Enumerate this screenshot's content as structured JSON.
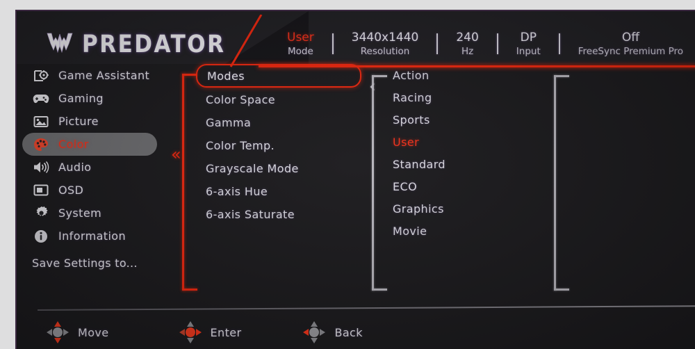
{
  "brand": {
    "name": "PREDATOR",
    "logo_icon": "predator-logo-icon"
  },
  "header": {
    "status": [
      {
        "value": "User",
        "label": "Mode",
        "accent": true
      },
      {
        "value": "3440x1440",
        "label": "Resolution",
        "accent": false
      },
      {
        "value": "240",
        "label": "Hz",
        "accent": false
      },
      {
        "value": "DP",
        "label": "Input",
        "accent": false
      },
      {
        "value": "Off",
        "label": "FreeSync Premium Pro",
        "accent": false
      }
    ]
  },
  "sidebar": {
    "items": [
      {
        "label": "Game Assistant",
        "icon": "game-assistant-icon",
        "active": false
      },
      {
        "label": "Gaming",
        "icon": "gamepad-icon",
        "active": false
      },
      {
        "label": "Picture",
        "icon": "picture-icon",
        "active": false
      },
      {
        "label": "Color",
        "icon": "palette-icon",
        "active": true
      },
      {
        "label": "Audio",
        "icon": "speaker-icon",
        "active": false
      },
      {
        "label": "OSD",
        "icon": "osd-icon",
        "active": false
      },
      {
        "label": "System",
        "icon": "gear-icon",
        "active": false
      },
      {
        "label": "Information",
        "icon": "info-icon",
        "active": false
      }
    ],
    "save_settings": "Save Settings to..."
  },
  "submenu": {
    "items": [
      {
        "label": "Modes",
        "selected": true
      },
      {
        "label": "Color Space",
        "selected": false
      },
      {
        "label": "Gamma",
        "selected": false
      },
      {
        "label": "Color Temp.",
        "selected": false
      },
      {
        "label": "Grayscale Mode",
        "selected": false
      },
      {
        "label": "6-axis Hue",
        "selected": false
      },
      {
        "label": "6-axis Saturate",
        "selected": false
      }
    ]
  },
  "options": {
    "items": [
      {
        "label": "Action",
        "active": false
      },
      {
        "label": "Racing",
        "active": false
      },
      {
        "label": "Sports",
        "active": false
      },
      {
        "label": "User",
        "active": true
      },
      {
        "label": "Standard",
        "active": false
      },
      {
        "label": "ECO",
        "active": false
      },
      {
        "label": "Graphics",
        "active": false
      },
      {
        "label": "Movie",
        "active": false
      }
    ]
  },
  "footer": {
    "items": [
      {
        "label": "Move",
        "icon": "dpad-move-icon"
      },
      {
        "label": "Enter",
        "icon": "dpad-enter-icon"
      },
      {
        "label": "Back",
        "icon": "dpad-back-icon"
      }
    ]
  },
  "colors": {
    "accent_red": "#f0270e",
    "text_light": "#e4e3e9",
    "panel_bg": "#1b1a1d",
    "highlight_gray": "#6d6d70"
  }
}
